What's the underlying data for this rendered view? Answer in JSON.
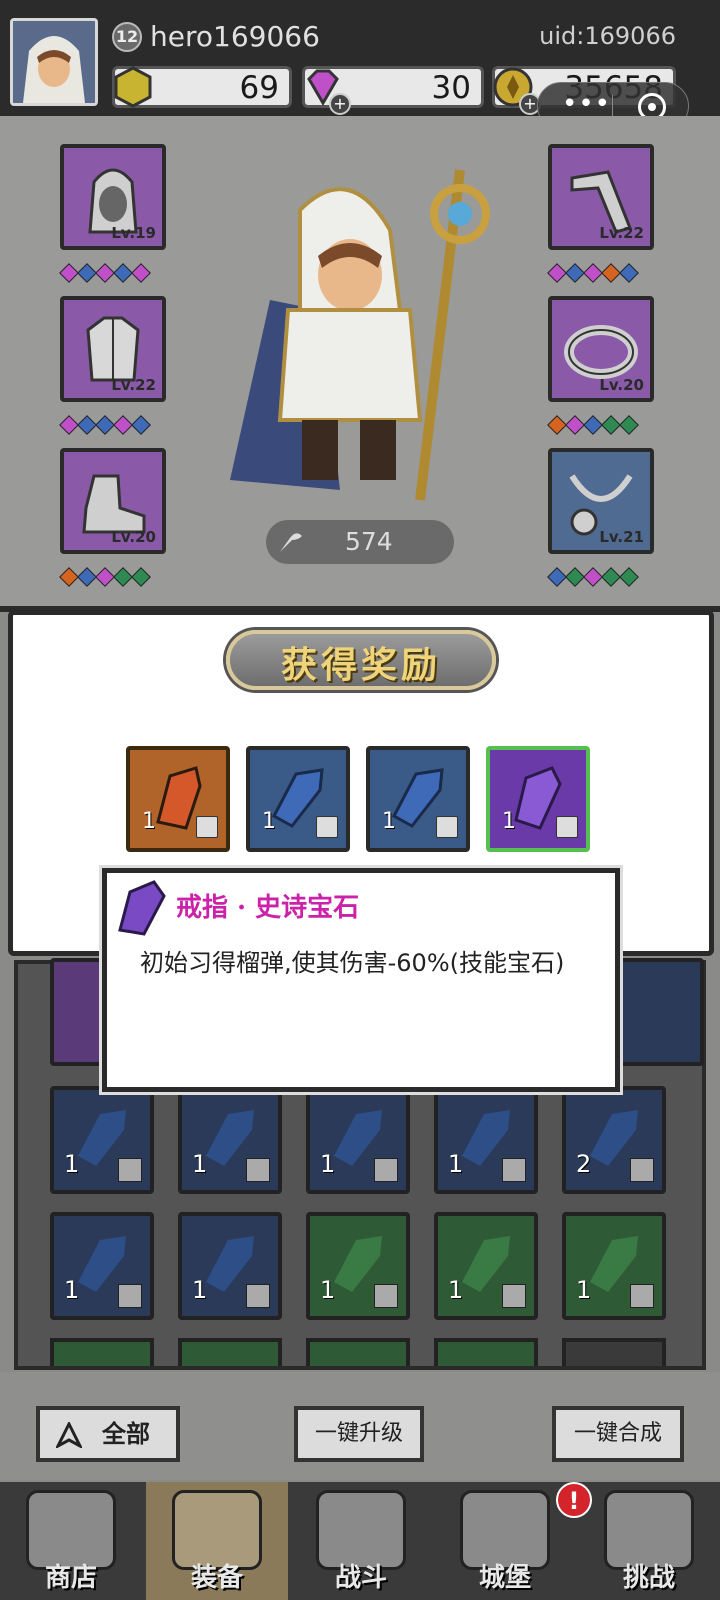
{
  "header": {
    "player_level": "12",
    "player_name": "hero169066",
    "uid": "uid:169066",
    "coins": "69",
    "gems": "30",
    "gold": "35658"
  },
  "equipment": {
    "left": [
      {
        "name": "hood",
        "level": "Lv.19"
      },
      {
        "name": "robe",
        "level": "Lv.22"
      },
      {
        "name": "boots",
        "level": "Lv.20"
      }
    ],
    "right": [
      {
        "name": "staff",
        "level": "Lv.22"
      },
      {
        "name": "ring",
        "level": "Lv.20"
      },
      {
        "name": "necklace",
        "level": "Lv.21"
      }
    ],
    "power": "574"
  },
  "reward_popup": {
    "title": "获得奖励",
    "items": [
      {
        "count": "1",
        "color": "#c45a22",
        "frame": "#b07a30"
      },
      {
        "count": "1",
        "color": "#3e6ab8",
        "frame": "#5a5a5a"
      },
      {
        "count": "1",
        "color": "#3e6ab8",
        "frame": "#5a5a5a"
      },
      {
        "count": "1",
        "color": "#7a4ac4",
        "frame": "#55c050"
      }
    ]
  },
  "tooltip": {
    "title": "戒指 · 史诗宝石",
    "description": "初始习得榴弹,使其伤害-60%(技能宝石)"
  },
  "inventory": {
    "row1": [
      {
        "count": "1"
      },
      {
        "count": "1"
      },
      {
        "count": "1"
      },
      {
        "count": "1"
      },
      {
        "count": "2"
      }
    ],
    "row2": [
      {
        "count": "1"
      },
      {
        "count": "1"
      },
      {
        "count": "1"
      },
      {
        "count": "1"
      },
      {
        "count": "1"
      }
    ]
  },
  "controls": {
    "filter_label": "全部",
    "upgrade_all": "一键升级",
    "merge_all": "一键合成"
  },
  "nav": {
    "shop": "商店",
    "equipment": "装备",
    "battle": "战斗",
    "castle": "城堡",
    "challenge": "挑战",
    "alert": "!"
  }
}
